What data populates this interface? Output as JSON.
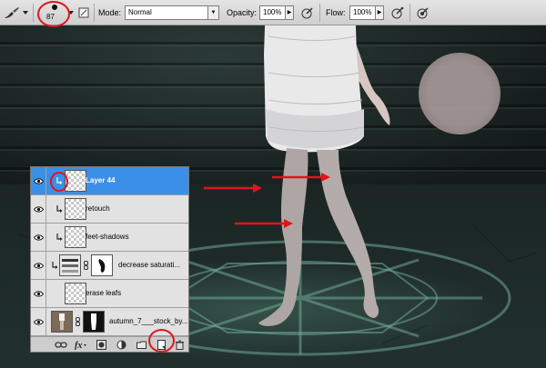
{
  "options_bar": {
    "brush_size": "87",
    "mode_label": "Mode:",
    "mode_value": "Normal",
    "opacity_label": "Opacity:",
    "opacity_value": "100%",
    "flow_label": "Flow:",
    "flow_value": "100%"
  },
  "layers": [
    {
      "name": "Layer 44",
      "selected": true,
      "type": "empty"
    },
    {
      "name": "retouch",
      "selected": false,
      "type": "empty"
    },
    {
      "name": "feet-shadows",
      "selected": false,
      "type": "empty"
    },
    {
      "name": "decrease saturati...",
      "selected": false,
      "type": "adjustment"
    },
    {
      "name": "erase leafs",
      "selected": false,
      "type": "empty"
    },
    {
      "name": "autumn_7___stock_by...",
      "selected": false,
      "type": "photo"
    }
  ],
  "colors": {
    "selection": "#3b8fe6",
    "annotation_red": "#e0141c",
    "brush_cursor": "#9e8f8f"
  }
}
